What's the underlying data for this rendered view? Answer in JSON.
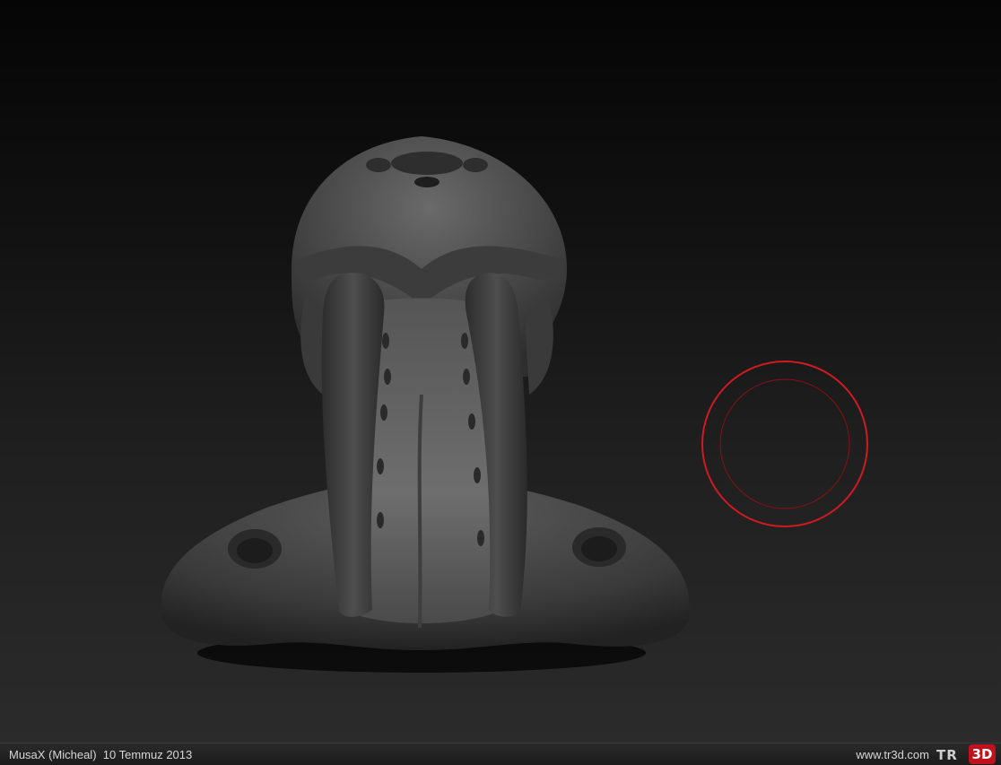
{
  "viewport": {
    "model_icon": "sculpted-creature-head",
    "brush_icon": "brush-cursor-circle",
    "brush_color": "#d01a22"
  },
  "footer": {
    "credit": "MusaX (Micheal)  10 Temmuz 2013",
    "site": "www.tr3d.com",
    "logo_prefix": "TR",
    "logo_suffix": "3D",
    "logo_color": "#c0121d"
  }
}
